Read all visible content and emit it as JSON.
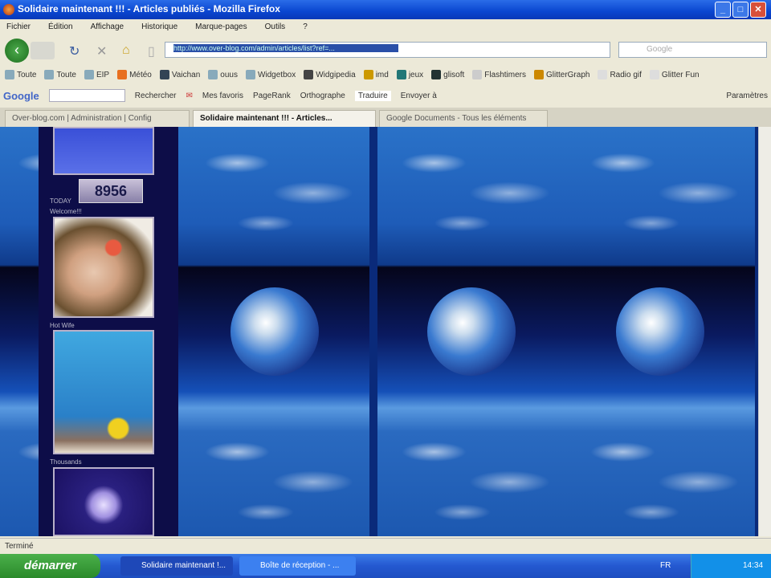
{
  "window": {
    "title": "Solidaire maintenant !!! - Articles publiés - Mozilla Firefox"
  },
  "menu": [
    "Fichier",
    "Édition",
    "Affichage",
    "Historique",
    "Marque-pages",
    "Outils",
    "?"
  ],
  "nav": {
    "url": "http://www.over-blog.com/admin/articles/list?ref=...",
    "search_placeholder": "Google"
  },
  "bookmarks": [
    "Toute",
    "Toute",
    "EIP",
    "Météo",
    "Vaichan",
    "ouus",
    "Widgetbox",
    "Widgipedia",
    "imd",
    "jeux",
    "glisoft",
    "Flashtimers",
    "GlitterGraph",
    "Radio gif",
    "Glitter Fun"
  ],
  "google_bar": {
    "logo": "Google",
    "search_label": "Rechercher",
    "bookmarks_label": "Mes favoris",
    "pagerank": "PageRank",
    "spell": "Orthographe",
    "translate": "Traduire",
    "send": "Envoyer à",
    "settings": "Paramètres"
  },
  "tabs": [
    {
      "label": "Over-blog.com | Administration | Config",
      "active": false
    },
    {
      "label": "Solidaire maintenant !!! - Articles...",
      "active": true
    },
    {
      "label": "Google Documents - Tous les éléments",
      "active": false
    }
  ],
  "sidebar": {
    "counter": "8956",
    "today_label": "TODAY",
    "welcome_label": "Welcome!!!",
    "hello_label": "Hot Wife",
    "second_label": "Thousands"
  },
  "status": "Terminé",
  "taskbar": {
    "start": "démarrer",
    "tasks": [
      "Solidaire maintenant !...",
      "Boîte de réception - ..."
    ],
    "lang": "FR",
    "clock": "14:34"
  }
}
